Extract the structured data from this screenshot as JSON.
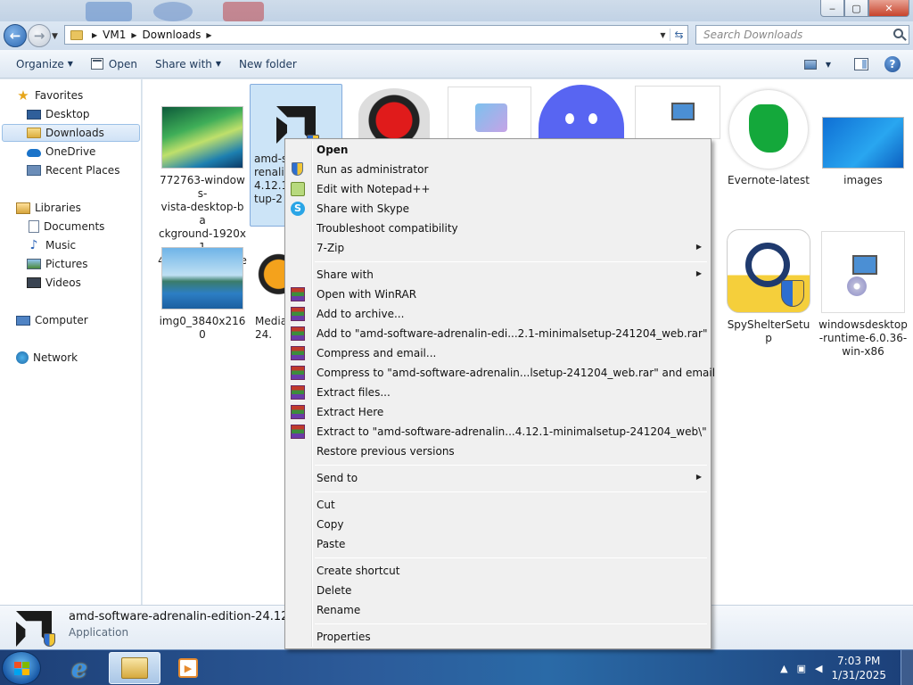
{
  "window": {
    "address": {
      "crumbs": [
        "VM1",
        "Downloads"
      ]
    },
    "search": {
      "placeholder": "Search Downloads"
    },
    "controls": {
      "minimize": "‒",
      "maximize": "▢",
      "close": "✕"
    }
  },
  "toolbar": {
    "organize_label": "Organize",
    "open_label": "Open",
    "share_label": "Share with",
    "new_folder_label": "New folder",
    "help_glyph": "?"
  },
  "sidebar": {
    "favorites": "Favorites",
    "favorites_items": [
      "Desktop",
      "Downloads",
      "OneDrive",
      "Recent Places"
    ],
    "libraries": "Libraries",
    "libraries_items": [
      "Documents",
      "Music",
      "Pictures",
      "Videos"
    ],
    "computer": "Computer",
    "network": "Network"
  },
  "files": [
    {
      "name": "772763-windows-vista-desktop-background-1920x1440-smartphone",
      "label_lines": [
        "772763-windows-",
        "vista-desktop-ba",
        "ckground-1920x1",
        "440-smartphone"
      ]
    },
    {
      "name": "amd-software-adrenalin-edition-24.12.1-minimalsetup-241204_web",
      "label_lines": [
        "amd-s",
        "renali",
        "4.12.1-",
        "tup-2"
      ]
    },
    {
      "name": "Evernote-latest",
      "label_lines": [
        "Evernote-latest"
      ]
    },
    {
      "name": "images",
      "label_lines": [
        "images"
      ]
    },
    {
      "name": "img0_3840x2160",
      "label_lines": [
        "img0_3840x2160"
      ]
    },
    {
      "name": "Media",
      "label_lines": [
        "Media",
        "24."
      ]
    },
    {
      "name": "SpyShelterSetup",
      "label_lines": [
        "SpyShelterSetup"
      ]
    },
    {
      "name": "windowsdesktop-runtime-6.0.36-win-x86",
      "label_lines": [
        "windowsdesktop",
        "-runtime-6.0.36-",
        "win-x86"
      ]
    }
  ],
  "details": {
    "name": "amd-software-adrenalin-edition-24.12.1-...",
    "type": "Application"
  },
  "context_menu": {
    "items": [
      {
        "label": "Open",
        "icon": "none"
      },
      {
        "label": "Run as administrator",
        "icon": "uac-shield-icon"
      },
      {
        "label": "Edit with Notepad++",
        "icon": "notepad-plus-plus-icon"
      },
      {
        "label": "Share with Skype",
        "icon": "skype-icon"
      },
      {
        "label": "Troubleshoot compatibility",
        "icon": "none"
      },
      {
        "label": "7-Zip",
        "icon": "none"
      },
      {
        "label": "Share with",
        "icon": "none"
      },
      {
        "label": "Open with WinRAR",
        "icon": "winrar-icon"
      },
      {
        "label": "Add to archive...",
        "icon": "winrar-icon"
      },
      {
        "label": "Add to \"amd-software-adrenalin-edi...2.1-minimalsetup-241204_web.rar\"",
        "icon": "winrar-icon"
      },
      {
        "label": "Compress and email...",
        "icon": "winrar-icon"
      },
      {
        "label": "Compress to \"amd-software-adrenalin...lsetup-241204_web.rar\" and email",
        "icon": "winrar-icon"
      },
      {
        "label": "Extract files...",
        "icon": "winrar-icon"
      },
      {
        "label": "Extract Here",
        "icon": "winrar-icon"
      },
      {
        "label": "Extract to \"amd-software-adrenalin...4.12.1-minimalsetup-241204_web\\\"",
        "icon": "winrar-icon"
      },
      {
        "label": "Restore previous versions",
        "icon": "none"
      },
      {
        "label": "Send to",
        "icon": "none"
      },
      {
        "label": "Cut",
        "icon": "none"
      },
      {
        "label": "Copy",
        "icon": "none"
      },
      {
        "label": "Paste",
        "icon": "none"
      },
      {
        "label": "Create shortcut",
        "icon": "none"
      },
      {
        "label": "Delete",
        "icon": "none"
      },
      {
        "label": "Rename",
        "icon": "none"
      },
      {
        "label": "Properties",
        "icon": "none"
      }
    ]
  },
  "taskbar": {
    "time": "7:03 PM",
    "date": "1/31/2025"
  },
  "colors": {
    "selection": "#cce4f7",
    "taskbar": "#2c5b9a",
    "menu_bg": "#f0f0f0"
  }
}
